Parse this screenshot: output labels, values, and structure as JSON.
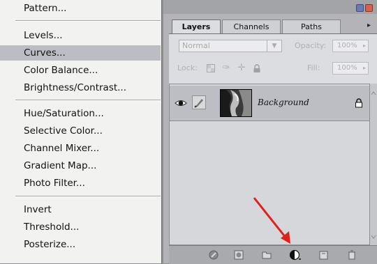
{
  "menu": {
    "items": [
      {
        "label": "Pattern...",
        "selected": false
      },
      {
        "label": "Levels...",
        "selected": false
      },
      {
        "label": "Curves...",
        "selected": true
      },
      {
        "label": "Color Balance...",
        "selected": false
      },
      {
        "label": "Brightness/Contrast...",
        "selected": false
      },
      {
        "label": "Hue/Saturation...",
        "selected": false
      },
      {
        "label": "Selective Color...",
        "selected": false
      },
      {
        "label": "Channel Mixer...",
        "selected": false
      },
      {
        "label": "Gradient Map...",
        "selected": false
      },
      {
        "label": "Photo Filter...",
        "selected": false
      },
      {
        "label": "Invert",
        "selected": false
      },
      {
        "label": "Threshold...",
        "selected": false
      },
      {
        "label": "Posterize...",
        "selected": false
      }
    ],
    "selected_color": "#bcbcc4"
  },
  "palette": {
    "tabs": [
      {
        "label": "Layers",
        "active": true
      },
      {
        "label": "Channels",
        "active": false
      },
      {
        "label": "Paths",
        "active": false
      }
    ],
    "blend_mode": "Normal",
    "opacity_label": "Opacity:",
    "opacity_value": "100%",
    "lock_label": "Lock:",
    "fill_label": "Fill:",
    "fill_value": "100%",
    "layers": [
      {
        "name": "Background",
        "visible": true,
        "locked": true
      }
    ],
    "bottom_icons": [
      "link-layers-icon",
      "layer-style-icon",
      "layer-mask-icon",
      "new-adjustment-layer-icon",
      "new-group-icon",
      "new-layer-icon",
      "trash-icon"
    ],
    "highlighted_icon": "new-adjustment-layer-icon",
    "arrow_color": "#e0201a"
  }
}
